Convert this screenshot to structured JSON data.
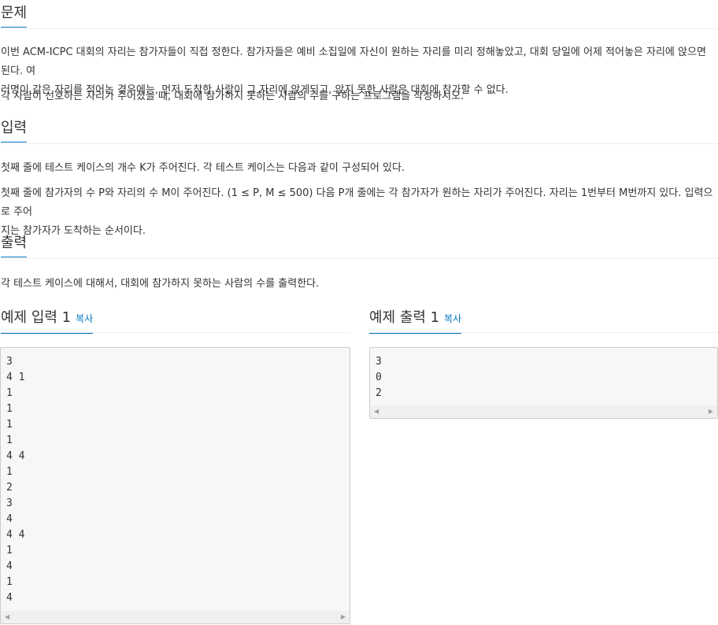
{
  "problem": {
    "title": "문제",
    "line1": "이번 ACM-ICPC 대회의 자리는 참가자들이 직접 정한다. 참가자들은 예비 소집일에 자신이 원하는 자리를 미리 정해놓았고, 대회 당일에 어제 적어놓은 자리에 앉으면 된다. 여",
    "line2": "러명이 같은 자리를 적어논 경우에는, 먼저 도착한 사람이 그 자리에 앉게되고, 앉지 못한 사람은 대회에 참가할 수 없다.",
    "line3": "각 사람이 선호하는 자리가 주어졌을 때, 대회에 참가하지 못하는 사람의 수를 구하는 프로그램을 작성하시오."
  },
  "input": {
    "title": "입력",
    "line1": "첫째 줄에 테스트 케이스의 개수 K가 주어진다. 각 테스트 케이스는 다음과 같이 구성되어 있다.",
    "line2": "첫째 줄에 참가자의 수 P와 자리의 수 M이 주어진다. (1 ≤ P, M ≤ 500) 다음 P개 줄에는 각 참가자가 원하는 자리가 주어진다. 자리는 1번부터 M번까지 있다. 입력으로 주어",
    "line3": "지는 참가자가 도착하는 순서이다."
  },
  "output": {
    "title": "출력",
    "line1": "각 테스트 케이스에 대해서, 대회에 참가하지 못하는 사람의 수를 출력한다."
  },
  "sample_input": {
    "title": "예제 입력 1",
    "copy_label": "복사",
    "content": "3\n4 1\n1\n1\n1\n1\n4 4\n1\n2\n3\n4\n4 4\n1\n4\n1\n4"
  },
  "sample_output": {
    "title": "예제 출력 1",
    "copy_label": "복사",
    "content": "3\n0\n2"
  },
  "icons": {
    "scroll_left": "◀",
    "scroll_right": "▶"
  }
}
